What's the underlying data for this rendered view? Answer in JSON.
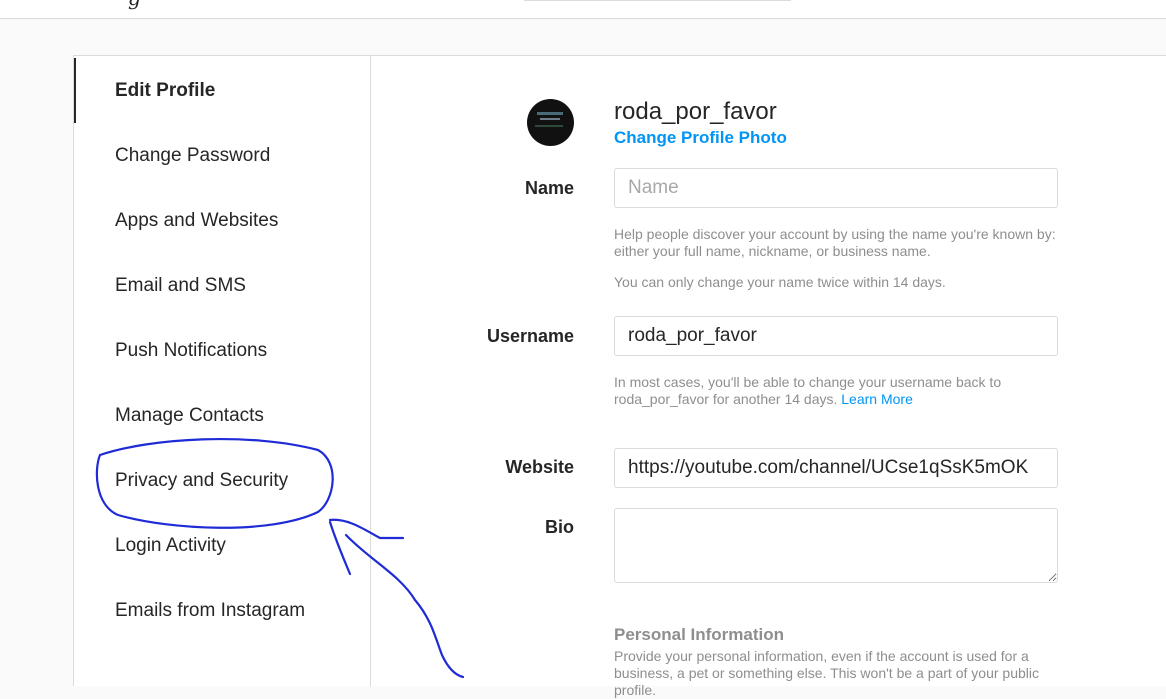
{
  "sidebar": {
    "items": [
      {
        "label": "Edit Profile",
        "active": true
      },
      {
        "label": "Change Password"
      },
      {
        "label": "Apps and Websites"
      },
      {
        "label": "Email and SMS"
      },
      {
        "label": "Push Notifications"
      },
      {
        "label": "Manage Contacts"
      },
      {
        "label": "Privacy and Security"
      },
      {
        "label": "Login Activity"
      },
      {
        "label": "Emails from Instagram"
      }
    ]
  },
  "profile": {
    "username": "roda_por_favor",
    "change_photo": "Change Profile Photo"
  },
  "form": {
    "name": {
      "label": "Name",
      "placeholder": "Name",
      "value": "",
      "help1": "Help people discover your account by using the name you're known by: either your full name, nickname, or business name.",
      "help2": "You can only change your name twice within 14 days."
    },
    "username": {
      "label": "Username",
      "value": "roda_por_favor",
      "help": "In most cases, you'll be able to change your username back to roda_por_favor for another 14 days.",
      "learn_more": "Learn More"
    },
    "website": {
      "label": "Website",
      "value": "https://youtube.com/channel/UCse1qSsK5mOK"
    },
    "bio": {
      "label": "Bio",
      "value": ""
    },
    "personal_info": {
      "title": "Personal Information",
      "help": "Provide your personal information, even if the account is used for a business, a pet or something else. This won't be a part of your public profile."
    }
  },
  "annotation": {
    "color": "#1f2bd6"
  },
  "icons": {
    "avatar": "profile-photo",
    "logo": "instagram-logo-fragment"
  }
}
